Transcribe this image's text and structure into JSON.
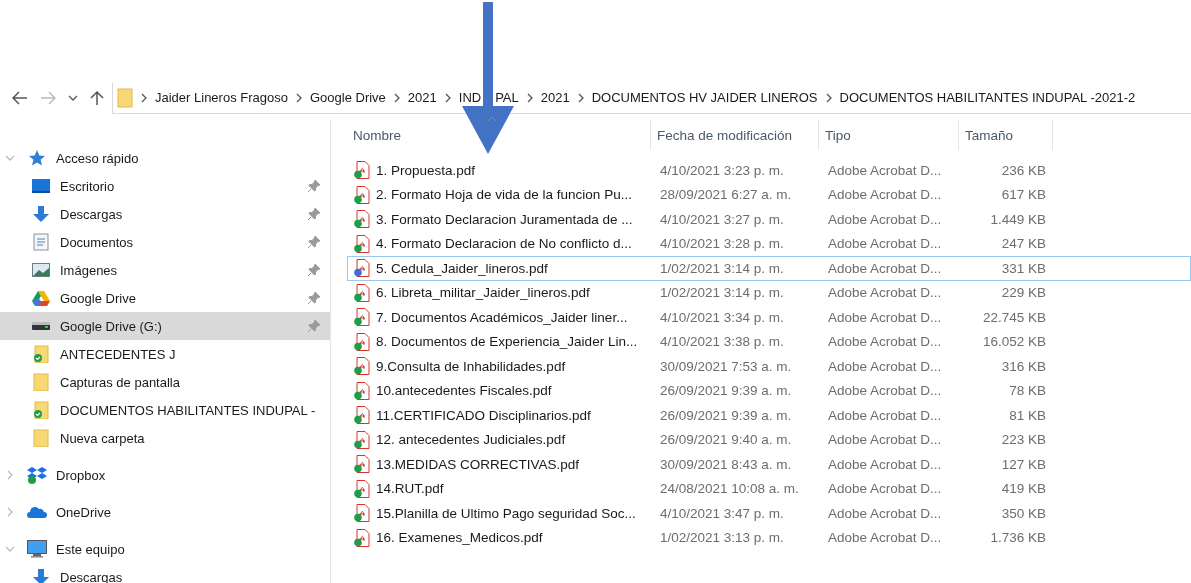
{
  "breadcrumb": [
    [
      "Jaider Lineros Fragoso"
    ],
    [
      "Google Drive"
    ],
    [
      "2021"
    ],
    [
      "IND",
      "PAL"
    ],
    [
      "2021"
    ],
    [
      "DOCUMENTOS HV JAIDER LINEROS"
    ],
    [
      "DOCUMENTOS HABILITANTES INDUPAL -2021-2"
    ]
  ],
  "sidebar": {
    "items": [
      {
        "label": "Acceso rápido",
        "kind": "star",
        "expanded": true,
        "selected": false,
        "children": [
          {
            "label": "Escritorio",
            "kind": "desktop",
            "pinned": true,
            "selected": false
          },
          {
            "label": "Descargas",
            "kind": "download",
            "pinned": true,
            "selected": false
          },
          {
            "label": "Documentos",
            "kind": "document",
            "pinned": true,
            "selected": false
          },
          {
            "label": "Imágenes",
            "kind": "images",
            "pinned": true,
            "selected": false
          },
          {
            "label": "Google Drive",
            "kind": "gdrive",
            "pinned": true,
            "selected": false
          },
          {
            "label": "Google Drive (G:)",
            "kind": "drive",
            "pinned": true,
            "selected": true
          },
          {
            "label": "ANTECEDENTES J",
            "kind": "synced-folder",
            "pinned": false,
            "selected": false
          },
          {
            "label": "Capturas de pantalla",
            "kind": "folder",
            "pinned": false,
            "selected": false
          },
          {
            "label": "DOCUMENTOS HABILITANTES INDUPAL -",
            "kind": "synced-folder",
            "pinned": false,
            "selected": false
          },
          {
            "label": "Nueva carpeta",
            "kind": "folder",
            "pinned": false,
            "selected": false
          }
        ]
      },
      {
        "label": "Dropbox",
        "kind": "dropbox",
        "expanded": false,
        "selected": false
      },
      {
        "label": "OneDrive",
        "kind": "onedrive",
        "expanded": false,
        "selected": false
      },
      {
        "label": "Este equipo",
        "kind": "computer",
        "expanded": true,
        "selected": false,
        "children": [
          {
            "label": "Descargas",
            "kind": "download",
            "pinned": false,
            "selected": false
          }
        ]
      }
    ]
  },
  "table": {
    "columns": [
      "Nombre",
      "Fecha de modificación",
      "Tipo",
      "Tamaño"
    ],
    "rows": [
      {
        "name": "1. Propuesta.pdf",
        "date": "4/10/2021 3:23 p. m.",
        "type": "Adobe Acrobat D...",
        "size": "236 KB",
        "color": "#1e9e4a",
        "selected": false
      },
      {
        "name": "2. Formato Hoja de vida de la funcion Pu...",
        "date": "28/09/2021 6:27 a. m.",
        "type": "Adobe Acrobat D...",
        "size": "617 KB",
        "color": "#1e9e4a",
        "selected": false
      },
      {
        "name": "3. Formato Declaracion Juramentada de ...",
        "date": "4/10/2021 3:27 p. m.",
        "type": "Adobe Acrobat D...",
        "size": "1.449 KB",
        "color": "#1e9e4a",
        "selected": false
      },
      {
        "name": "4. Formato Declaracion de No conflicto d...",
        "date": "4/10/2021 3:28 p. m.",
        "type": "Adobe Acrobat D...",
        "size": "247 KB",
        "color": "#1e9e4a",
        "selected": false
      },
      {
        "name": "5. Cedula_Jaider_lineros.pdf",
        "date": "1/02/2021 3:14 p. m.",
        "type": "Adobe Acrobat D...",
        "size": "331 KB",
        "color": "#3b6fd6",
        "selected": true
      },
      {
        "name": "6. Libreta_militar_Jaider_lineros.pdf",
        "date": "1/02/2021 3:14 p. m.",
        "type": "Adobe Acrobat D...",
        "size": "229 KB",
        "color": "#1e9e4a",
        "selected": false
      },
      {
        "name": "7. Documentos  Académicos_Jaider liner...",
        "date": "4/10/2021 3:34 p. m.",
        "type": "Adobe Acrobat D...",
        "size": "22.745 KB",
        "color": "#1e9e4a",
        "selected": false
      },
      {
        "name": "8. Documentos de Experiencia_Jaider Lin...",
        "date": "4/10/2021 3:38 p. m.",
        "type": "Adobe Acrobat D...",
        "size": "16.052 KB",
        "color": "#1e9e4a",
        "selected": false
      },
      {
        "name": "9.Consulta de Inhabilidades.pdf",
        "date": "30/09/2021 7:53 a. m.",
        "type": "Adobe Acrobat D...",
        "size": "316 KB",
        "color": "#1e9e4a",
        "selected": false
      },
      {
        "name": "10.antecedentes Fiscales.pdf",
        "date": "26/09/2021 9:39 a. m.",
        "type": "Adobe Acrobat D...",
        "size": "78 KB",
        "color": "#1e9e4a",
        "selected": false
      },
      {
        "name": "11.CERTIFICADO Disciplinarios.pdf",
        "date": "26/09/2021 9:39 a. m.",
        "type": "Adobe Acrobat D...",
        "size": "81 KB",
        "color": "#1e9e4a",
        "selected": false
      },
      {
        "name": "12. antecedentes Judiciales.pdf",
        "date": "26/09/2021 9:40 a. m.",
        "type": "Adobe Acrobat D...",
        "size": "223 KB",
        "color": "#1e9e4a",
        "selected": false
      },
      {
        "name": "13.MEDIDAS CORRECTIVAS.pdf",
        "date": "30/09/2021 8:43 a. m.",
        "type": "Adobe Acrobat D...",
        "size": "127 KB",
        "color": "#1e9e4a",
        "selected": false
      },
      {
        "name": "14.RUT.pdf",
        "date": "24/08/2021 10:08 a. m.",
        "type": "Adobe Acrobat D...",
        "size": "419 KB",
        "color": "#1e9e4a",
        "selected": false
      },
      {
        "name": "15.Planilla de Ultimo Pago seguridad Soc...",
        "date": "4/10/2021 3:47 p. m.",
        "type": "Adobe Acrobat D...",
        "size": "350 KB",
        "color": "#1e9e4a",
        "selected": false
      },
      {
        "name": "16. Examenes_Medicos.pdf",
        "date": "1/02/2021 3:13 p. m.",
        "type": "Adobe Acrobat D...",
        "size": "1.736 KB",
        "color": "#1e9e4a",
        "selected": false
      }
    ]
  }
}
